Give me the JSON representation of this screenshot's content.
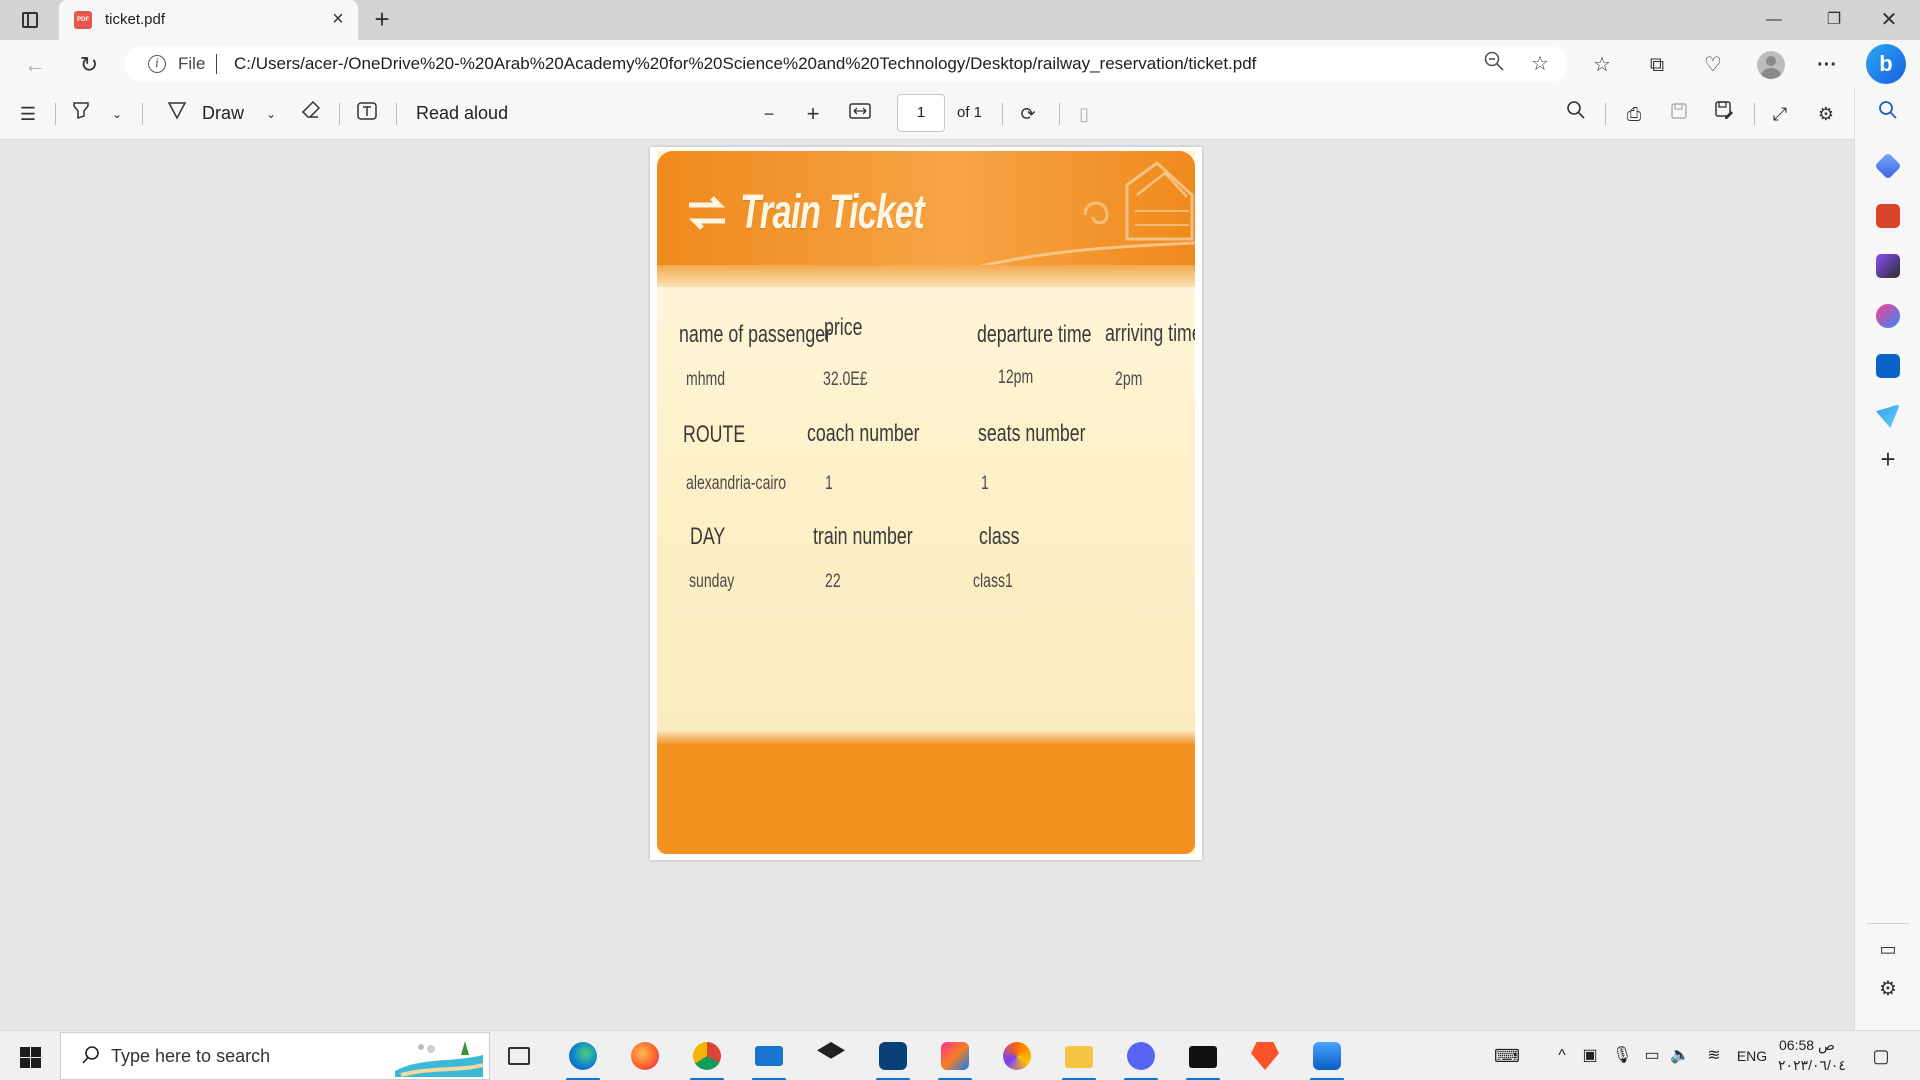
{
  "browser": {
    "tab": {
      "title": "ticket.pdf",
      "favicon": "pdf-icon"
    },
    "address": {
      "scheme_label": "File",
      "url": "C:/Users/acer-/OneDrive%20-%20Arab%20Academy%20for%20Science%20and%20Technology/Desktop/railway_reservation/ticket.pdf"
    }
  },
  "pdf_toolbar": {
    "draw_label": "Draw",
    "read_aloud_label": "Read aloud",
    "page_number": "1",
    "page_of": "of 1"
  },
  "ticket": {
    "title": "Train Ticket",
    "labels": {
      "name": "name of passenger",
      "price": "price",
      "departure": "departure time",
      "arriving": "arriving time",
      "route": "ROUTE",
      "coach": "coach number",
      "seats": "seats number",
      "day": "DAY",
      "train": "train number",
      "class": "class"
    },
    "values": {
      "name": "mhmd",
      "price": "32.0E£",
      "departure": "12pm",
      "arriving": "2pm",
      "route": "alexandria-cairo",
      "coach": "1",
      "seats": "1",
      "day": "sunday",
      "train": "22",
      "class": "class1"
    }
  },
  "taskbar": {
    "search_placeholder": "Type here to search",
    "language": "ENG",
    "time": "06:58 ص",
    "date": "٢٠٢٣/٠٦/٠٤"
  },
  "colors": {
    "ticket_orange": "#f3911f",
    "ticket_cream": "#fdf3cd",
    "accent_blue": "#0078d4"
  }
}
